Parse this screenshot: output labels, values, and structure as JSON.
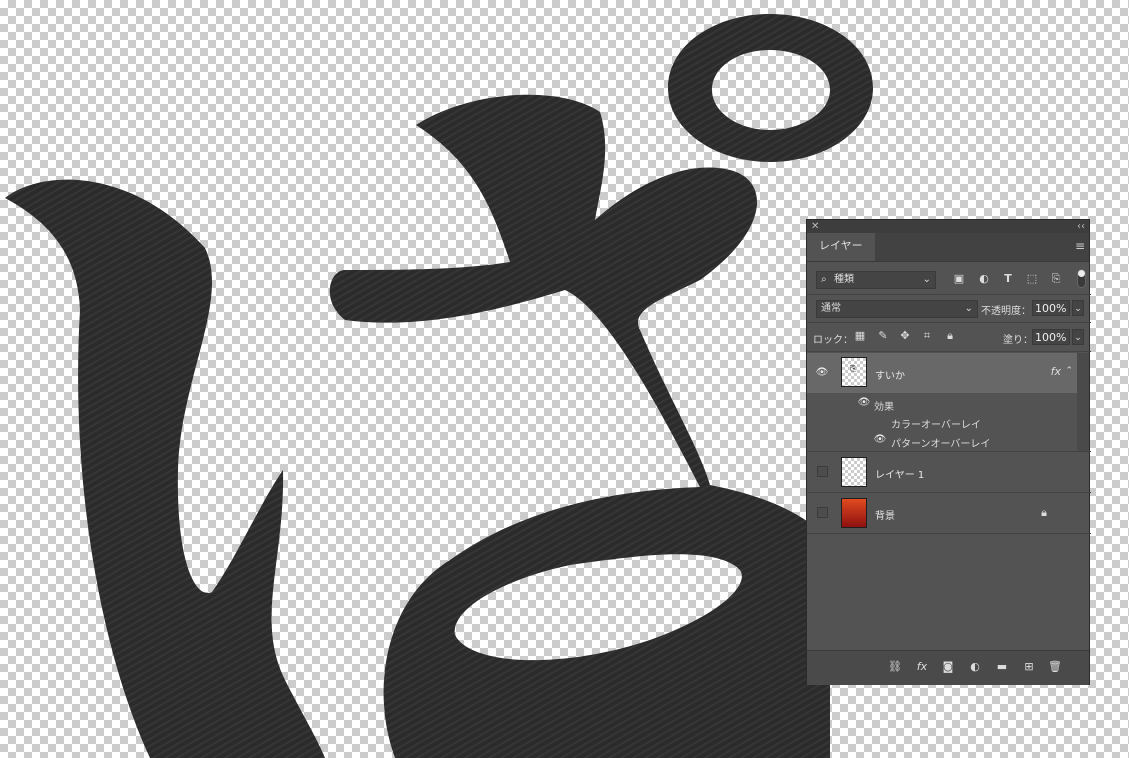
{
  "panel": {
    "tab_label": "レイヤー",
    "filter": {
      "kind_label": "種類"
    },
    "blend_mode": "通常",
    "opacity_label": "不透明度：",
    "opacity_value": "100%",
    "lock_label": "ロック：",
    "fill_label": "塗り：",
    "fill_value": "100%",
    "layers": [
      {
        "name": "すいか",
        "fx": "fx",
        "effects_label": "効果",
        "effects": [
          {
            "name": "カラーオーバーレイ"
          },
          {
            "name": "パターンオーバーレイ"
          }
        ]
      },
      {
        "name": "レイヤー 1"
      },
      {
        "name": "背景"
      }
    ]
  },
  "icons": {
    "filter": [
      "image-filter-icon",
      "adjustment-filter-icon",
      "type-filter-icon",
      "shape-filter-icon",
      "smartobject-filter-icon"
    ],
    "lock": [
      "lock-transparent-icon",
      "lock-paint-icon",
      "lock-position-icon",
      "lock-artboard-icon",
      "lock-all-icon"
    ],
    "bottom": [
      "link-icon",
      "fx-icon",
      "mask-icon",
      "adjustment-icon",
      "folder-icon",
      "new-layer-icon",
      "trash-icon"
    ]
  },
  "colors": {
    "panel_bg": "#535353",
    "selected_row": "#686868",
    "glyph_fill": "#2a2a2a"
  }
}
